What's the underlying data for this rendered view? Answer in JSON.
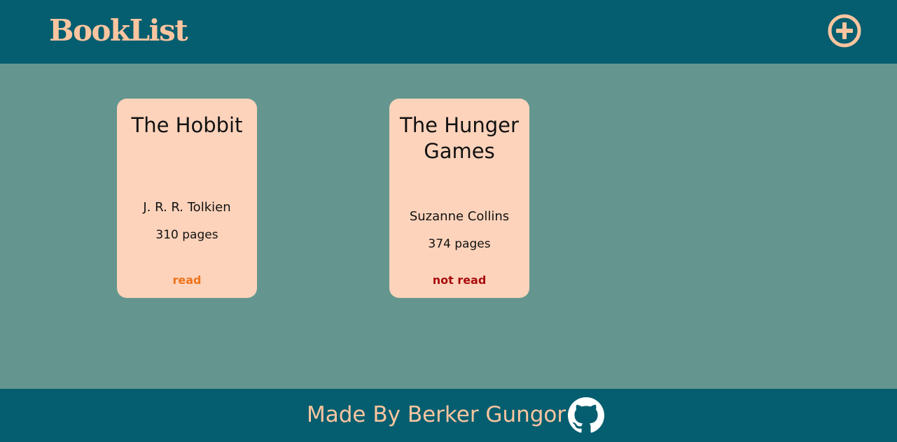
{
  "header": {
    "logo": "BookList",
    "add_icon": "plus-circle-icon"
  },
  "books": [
    {
      "title": "The Hobbit",
      "author": "J. R. R. Tolkien",
      "pages": "310 pages",
      "status": "read",
      "status_color": "#f0731a"
    },
    {
      "title": "The Hunger Games",
      "author": "Suzanne Collins",
      "pages": "374 pages",
      "status": "not read",
      "status_color": "#a80d0d"
    }
  ],
  "footer": {
    "credit": "Made By Berker Gungor",
    "github_icon": "github-icon"
  },
  "colors": {
    "header_bg": "#055e6f",
    "page_bg": "#64968f",
    "card_bg": "#fdd3bb",
    "accent": "#fcc5a0"
  }
}
